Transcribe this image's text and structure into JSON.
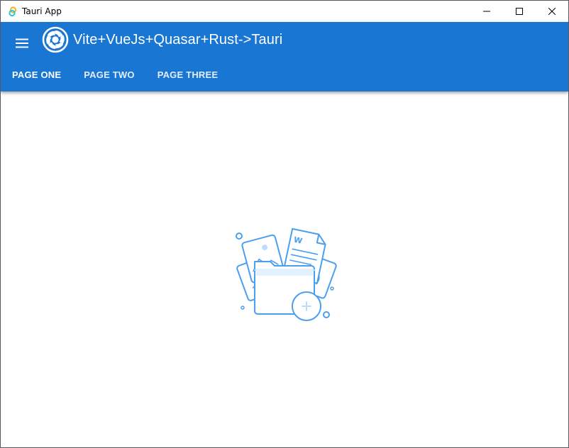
{
  "window": {
    "title": "Tauri App",
    "controls": [
      "minimize",
      "maximize",
      "close"
    ]
  },
  "header": {
    "menu_icon": "hamburger-menu-icon",
    "logo_icon": "quasar-logo-icon",
    "title": "Vite+VueJs+Quasar+Rust->Tauri",
    "color": "#1976d2"
  },
  "tabs": [
    {
      "label": "PAGE ONE"
    },
    {
      "label": "PAGE TWO"
    },
    {
      "label": "PAGE THREE"
    }
  ],
  "main": {
    "illustration_icon": "empty-folder-illustration",
    "accent": "#4a9ff0"
  }
}
